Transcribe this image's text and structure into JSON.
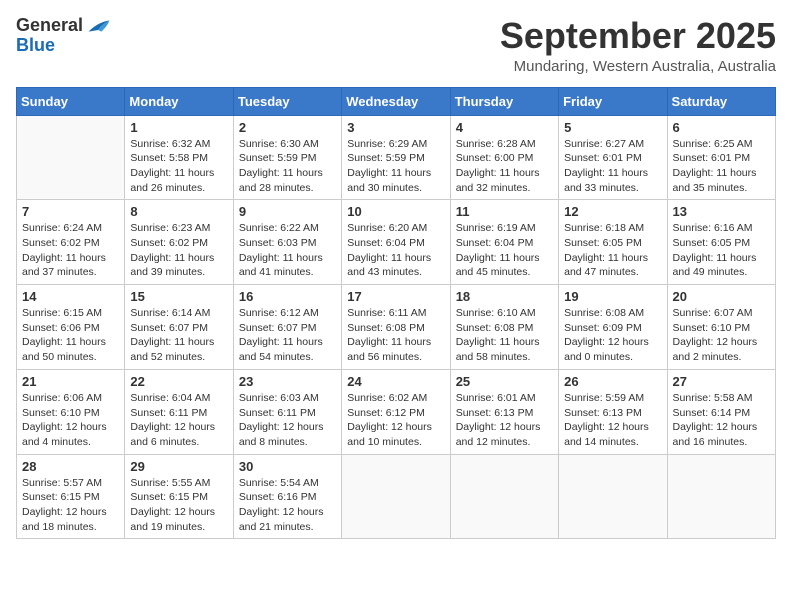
{
  "logo": {
    "text_general": "General",
    "text_blue": "Blue"
  },
  "title": "September 2025",
  "location": "Mundaring, Western Australia, Australia",
  "days_of_week": [
    "Sunday",
    "Monday",
    "Tuesday",
    "Wednesday",
    "Thursday",
    "Friday",
    "Saturday"
  ],
  "weeks": [
    [
      {
        "day": "",
        "sunrise": "",
        "sunset": "",
        "daylight": ""
      },
      {
        "day": "1",
        "sunrise": "6:32 AM",
        "sunset": "5:58 PM",
        "daylight": "11 hours and 26 minutes."
      },
      {
        "day": "2",
        "sunrise": "6:30 AM",
        "sunset": "5:59 PM",
        "daylight": "11 hours and 28 minutes."
      },
      {
        "day": "3",
        "sunrise": "6:29 AM",
        "sunset": "5:59 PM",
        "daylight": "11 hours and 30 minutes."
      },
      {
        "day": "4",
        "sunrise": "6:28 AM",
        "sunset": "6:00 PM",
        "daylight": "11 hours and 32 minutes."
      },
      {
        "day": "5",
        "sunrise": "6:27 AM",
        "sunset": "6:01 PM",
        "daylight": "11 hours and 33 minutes."
      },
      {
        "day": "6",
        "sunrise": "6:25 AM",
        "sunset": "6:01 PM",
        "daylight": "11 hours and 35 minutes."
      }
    ],
    [
      {
        "day": "7",
        "sunrise": "6:24 AM",
        "sunset": "6:02 PM",
        "daylight": "11 hours and 37 minutes."
      },
      {
        "day": "8",
        "sunrise": "6:23 AM",
        "sunset": "6:02 PM",
        "daylight": "11 hours and 39 minutes."
      },
      {
        "day": "9",
        "sunrise": "6:22 AM",
        "sunset": "6:03 PM",
        "daylight": "11 hours and 41 minutes."
      },
      {
        "day": "10",
        "sunrise": "6:20 AM",
        "sunset": "6:04 PM",
        "daylight": "11 hours and 43 minutes."
      },
      {
        "day": "11",
        "sunrise": "6:19 AM",
        "sunset": "6:04 PM",
        "daylight": "11 hours and 45 minutes."
      },
      {
        "day": "12",
        "sunrise": "6:18 AM",
        "sunset": "6:05 PM",
        "daylight": "11 hours and 47 minutes."
      },
      {
        "day": "13",
        "sunrise": "6:16 AM",
        "sunset": "6:05 PM",
        "daylight": "11 hours and 49 minutes."
      }
    ],
    [
      {
        "day": "14",
        "sunrise": "6:15 AM",
        "sunset": "6:06 PM",
        "daylight": "11 hours and 50 minutes."
      },
      {
        "day": "15",
        "sunrise": "6:14 AM",
        "sunset": "6:07 PM",
        "daylight": "11 hours and 52 minutes."
      },
      {
        "day": "16",
        "sunrise": "6:12 AM",
        "sunset": "6:07 PM",
        "daylight": "11 hours and 54 minutes."
      },
      {
        "day": "17",
        "sunrise": "6:11 AM",
        "sunset": "6:08 PM",
        "daylight": "11 hours and 56 minutes."
      },
      {
        "day": "18",
        "sunrise": "6:10 AM",
        "sunset": "6:08 PM",
        "daylight": "11 hours and 58 minutes."
      },
      {
        "day": "19",
        "sunrise": "6:08 AM",
        "sunset": "6:09 PM",
        "daylight": "12 hours and 0 minutes."
      },
      {
        "day": "20",
        "sunrise": "6:07 AM",
        "sunset": "6:10 PM",
        "daylight": "12 hours and 2 minutes."
      }
    ],
    [
      {
        "day": "21",
        "sunrise": "6:06 AM",
        "sunset": "6:10 PM",
        "daylight": "12 hours and 4 minutes."
      },
      {
        "day": "22",
        "sunrise": "6:04 AM",
        "sunset": "6:11 PM",
        "daylight": "12 hours and 6 minutes."
      },
      {
        "day": "23",
        "sunrise": "6:03 AM",
        "sunset": "6:11 PM",
        "daylight": "12 hours and 8 minutes."
      },
      {
        "day": "24",
        "sunrise": "6:02 AM",
        "sunset": "6:12 PM",
        "daylight": "12 hours and 10 minutes."
      },
      {
        "day": "25",
        "sunrise": "6:01 AM",
        "sunset": "6:13 PM",
        "daylight": "12 hours and 12 minutes."
      },
      {
        "day": "26",
        "sunrise": "5:59 AM",
        "sunset": "6:13 PM",
        "daylight": "12 hours and 14 minutes."
      },
      {
        "day": "27",
        "sunrise": "5:58 AM",
        "sunset": "6:14 PM",
        "daylight": "12 hours and 16 minutes."
      }
    ],
    [
      {
        "day": "28",
        "sunrise": "5:57 AM",
        "sunset": "6:15 PM",
        "daylight": "12 hours and 18 minutes."
      },
      {
        "day": "29",
        "sunrise": "5:55 AM",
        "sunset": "6:15 PM",
        "daylight": "12 hours and 19 minutes."
      },
      {
        "day": "30",
        "sunrise": "5:54 AM",
        "sunset": "6:16 PM",
        "daylight": "12 hours and 21 minutes."
      },
      {
        "day": "",
        "sunrise": "",
        "sunset": "",
        "daylight": ""
      },
      {
        "day": "",
        "sunrise": "",
        "sunset": "",
        "daylight": ""
      },
      {
        "day": "",
        "sunrise": "",
        "sunset": "",
        "daylight": ""
      },
      {
        "day": "",
        "sunrise": "",
        "sunset": "",
        "daylight": ""
      }
    ]
  ]
}
